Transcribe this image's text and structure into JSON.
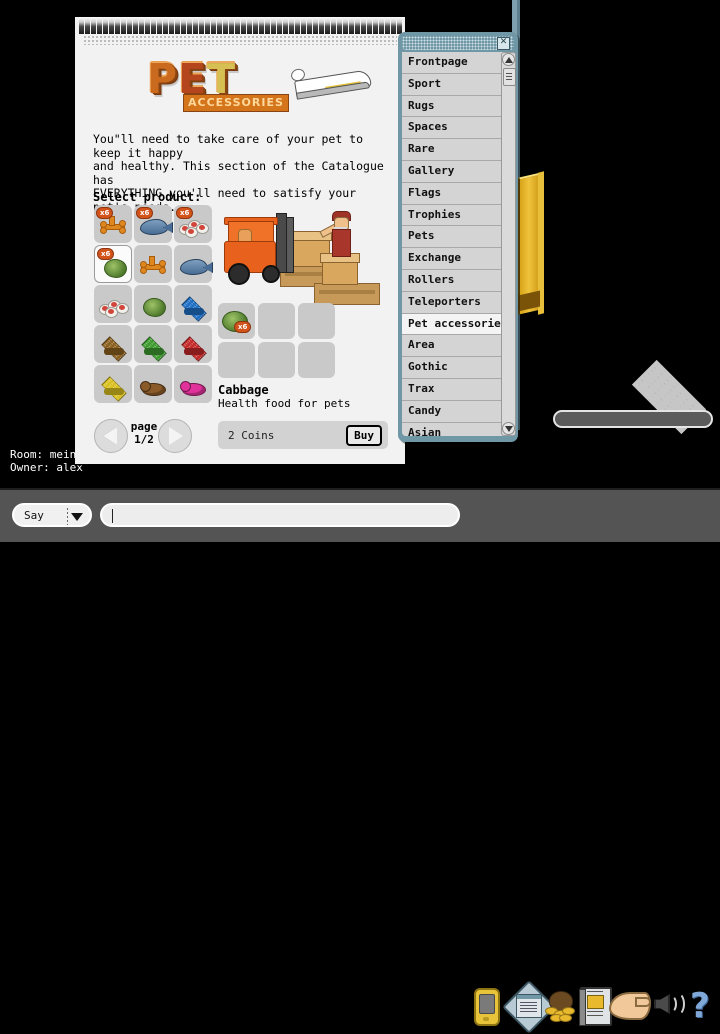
{
  "room": {
    "info_lines": "Room: mein r\nOwner: alex",
    "door_name": "yellow-door",
    "floor_tile_name": "floor-tile"
  },
  "catalogue": {
    "logo": {
      "l1": "P",
      "l2": "E",
      "l3": "T",
      "banner": "ACCESSORIES"
    },
    "blurb": "You\"ll need to take care of your pet to keep it happy\nand healthy. This section of the Catalogue has\nEVERYTHING you'll need to satisfy your pet's needs.",
    "select_label": "Select product:",
    "products": [
      {
        "name": "bones",
        "kind": "bone",
        "color": "#e08820",
        "badge": "x6"
      },
      {
        "name": "fish",
        "kind": "fish",
        "color": "#4a6d95",
        "badge": "x6"
      },
      {
        "name": "meat-plates",
        "kind": "meat",
        "color": "#d2453a",
        "badge": "x6"
      },
      {
        "name": "cabbage",
        "kind": "cabbage",
        "color": "#4f7a2c",
        "badge": "x6",
        "selected": true
      },
      {
        "name": "bones-single",
        "kind": "bone",
        "color": "#e08820",
        "badge": ""
      },
      {
        "name": "fish-single",
        "kind": "fish",
        "color": "#4a6d95",
        "badge": ""
      },
      {
        "name": "meat-single",
        "kind": "meat",
        "color": "#d2453a",
        "badge": ""
      },
      {
        "name": "cabbage-single",
        "kind": "cabbage",
        "color": "#4f7a2c",
        "badge": ""
      },
      {
        "name": "blanket-blue",
        "kind": "blanket",
        "color": "#1f6fc4",
        "badge": ""
      },
      {
        "name": "blanket-brown",
        "kind": "blanket",
        "color": "#8a6020",
        "badge": ""
      },
      {
        "name": "blanket-green",
        "kind": "blanket",
        "color": "#3f9b30",
        "badge": ""
      },
      {
        "name": "blanket-red",
        "kind": "blanket",
        "color": "#c42a2a",
        "badge": ""
      },
      {
        "name": "blanket-yellow",
        "kind": "blanket",
        "color": "#d9c020",
        "badge": ""
      },
      {
        "name": "pet-brown",
        "kind": "pet",
        "color": "#8a5a28",
        "badge": ""
      },
      {
        "name": "pet-pink",
        "kind": "pet",
        "color": "#e0329a",
        "badge": ""
      }
    ],
    "preview": {
      "slot_badge": "x6",
      "product_name": "Cabbage",
      "product_desc": "Health food for pets"
    },
    "pager": {
      "label_top": "page",
      "label_bottom": "1/2",
      "prev": "◀",
      "next": "▶"
    },
    "purchase": {
      "price": "2 Coins",
      "buy_label": "Buy"
    }
  },
  "categories": {
    "close_label": "✕",
    "items": [
      {
        "label": "Frontpage"
      },
      {
        "label": "Sport"
      },
      {
        "label": "Rugs"
      },
      {
        "label": "Spaces"
      },
      {
        "label": "Rare"
      },
      {
        "label": "Gallery"
      },
      {
        "label": "Flags"
      },
      {
        "label": "Trophies"
      },
      {
        "label": "Pets"
      },
      {
        "label": "Exchange"
      },
      {
        "label": "Rollers"
      },
      {
        "label": "Teleporters"
      },
      {
        "label": "Pet accessories",
        "active": true
      },
      {
        "label": "Area"
      },
      {
        "label": "Gothic"
      },
      {
        "label": "Trax"
      },
      {
        "label": "Candy"
      },
      {
        "label": "Asian"
      }
    ]
  },
  "toolbar": {
    "say_label": "Say",
    "chat_value": "",
    "icons": [
      {
        "name": "console-icon"
      },
      {
        "name": "navigator-icon"
      },
      {
        "name": "coins-icon"
      },
      {
        "name": "catalogue-icon"
      },
      {
        "name": "hand-icon"
      },
      {
        "name": "sound-icon"
      },
      {
        "name": "help-icon",
        "glyph": "?"
      }
    ]
  },
  "colors": {
    "panel_teal": "#6f97a6",
    "page_bg": "#f2f2f2",
    "toolbar_bg": "#545454",
    "accent_orange": "#d2541b"
  }
}
